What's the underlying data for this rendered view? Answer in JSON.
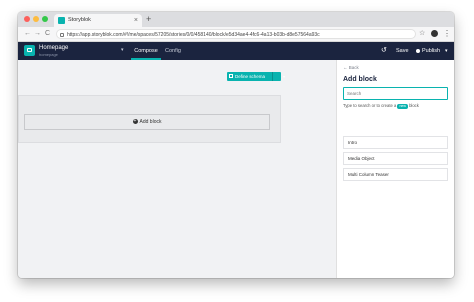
{
  "browser": {
    "tab_title": "Storyblok",
    "tab_close": "×",
    "new_tab": "+",
    "back": "←",
    "forward": "→",
    "reload": "C",
    "url": "https://app.storyblok.com/#!/me/spaces/57205/stories/0/0/458140/block/e5d34ae4-4fc6-4a13-b03b-d8e57564a93c",
    "star": "☆",
    "menu": "⋮"
  },
  "header": {
    "title": "Homepage",
    "subtitle": "homepage",
    "chevron": "▾",
    "tabs": {
      "compose": "Compose",
      "config": "Config"
    },
    "undo": "↺",
    "save": "Save",
    "publish": "Publish",
    "publish_chevron": "▾"
  },
  "canvas": {
    "define_schema": "Define schema",
    "define_chevron": "▾",
    "add_block": "Add block",
    "plus": "+"
  },
  "sidebar": {
    "back": "Back",
    "title": "Add block",
    "search_placeholder": "Search",
    "hint_prefix": "Type to search or to create a",
    "hint_badge": "new",
    "hint_suffix": "block",
    "components": [
      "Intro",
      "Media Object",
      "Multi Column Teaser"
    ]
  },
  "colors": {
    "accent": "#09b3af",
    "header_bg": "#1b243f"
  }
}
